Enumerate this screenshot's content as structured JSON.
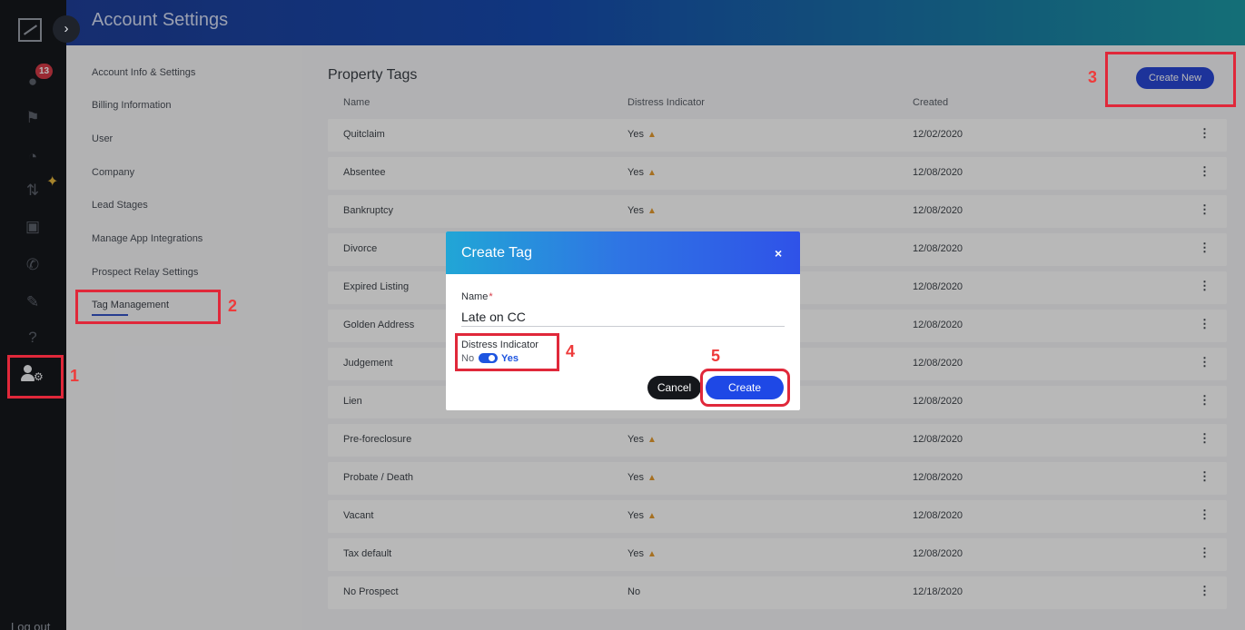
{
  "header": {
    "title": "Account Settings"
  },
  "rail": {
    "notification_count": "13",
    "logout_label": "Log out",
    "icons": [
      "chat-icon",
      "megaphone-icon",
      "speedometer-icon",
      "sort-icon",
      "contact-icon",
      "phone-icon",
      "pencil-icon",
      "help-icon",
      "user-settings-icon"
    ]
  },
  "settings_menu": {
    "items": [
      {
        "label": "Account Info & Settings"
      },
      {
        "label": "Billing Information"
      },
      {
        "label": "User"
      },
      {
        "label": "Company"
      },
      {
        "label": "Lead Stages"
      },
      {
        "label": "Manage App Integrations"
      },
      {
        "label": "Prospect Relay Settings"
      },
      {
        "label": "Tag Management",
        "active": true
      }
    ]
  },
  "main": {
    "title": "Property Tags",
    "create_new_label": "Create New",
    "columns": {
      "name": "Name",
      "distress": "Distress Indicator",
      "created": "Created"
    },
    "rows": [
      {
        "name": "Quitclaim",
        "distress": "Yes",
        "created": "12/02/2020"
      },
      {
        "name": "Absentee",
        "distress": "Yes",
        "created": "12/08/2020"
      },
      {
        "name": "Bankruptcy",
        "distress": "Yes",
        "created": "12/08/2020"
      },
      {
        "name": "Divorce",
        "distress": "",
        "created": "12/08/2020"
      },
      {
        "name": "Expired Listing",
        "distress": "",
        "created": "12/08/2020"
      },
      {
        "name": "Golden Address",
        "distress": "",
        "created": "12/08/2020"
      },
      {
        "name": "Judgement",
        "distress": "",
        "created": "12/08/2020"
      },
      {
        "name": "Lien",
        "distress": "",
        "created": "12/08/2020"
      },
      {
        "name": "Pre-foreclosure",
        "distress": "Yes",
        "created": "12/08/2020"
      },
      {
        "name": "Probate / Death",
        "distress": "Yes",
        "created": "12/08/2020"
      },
      {
        "name": "Vacant",
        "distress": "Yes",
        "created": "12/08/2020"
      },
      {
        "name": "Tax default",
        "distress": "Yes",
        "created": "12/08/2020"
      },
      {
        "name": "No Prospect",
        "distress": "No",
        "created": "12/18/2020"
      }
    ]
  },
  "modal": {
    "title": "Create Tag",
    "close_symbol": "×",
    "name_label": "Name",
    "required_mark": "*",
    "name_value": "Late on CC",
    "distress_label": "Distress Indicator",
    "toggle_off_label": "No",
    "toggle_on_label": "Yes",
    "toggle_state": "on",
    "cancel_label": "Cancel",
    "create_label": "Create"
  },
  "annotations": [
    "1",
    "2",
    "3",
    "4",
    "5"
  ],
  "colors": {
    "annotation": "#e0283a",
    "primary_button": "#1e48e6",
    "flame": "#e69b2e"
  }
}
